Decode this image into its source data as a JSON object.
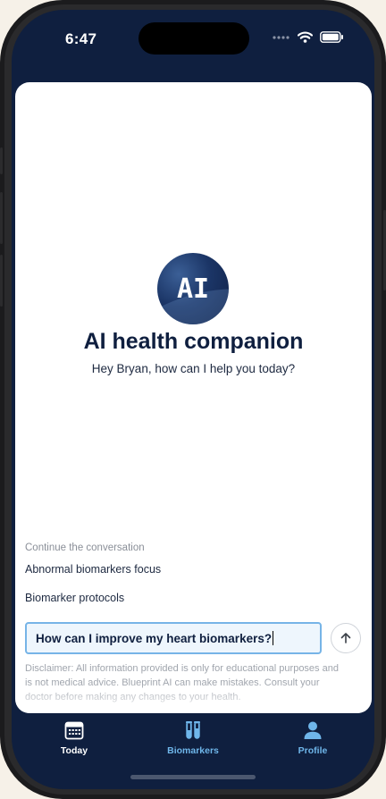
{
  "status_bar": {
    "time": "6:47"
  },
  "companion": {
    "avatar_text": "AI",
    "title": "AI health companion",
    "greeting": "Hey Bryan, how can I help you today?"
  },
  "conversation": {
    "section_label": "Continue the conversation",
    "suggestions": [
      "Abnormal biomarkers focus",
      "Biomarker protocols"
    ]
  },
  "input": {
    "value": "How can I improve my heart biomarkers?"
  },
  "disclaimer": "Disclaimer: All information provided is only for educational purposes and is not medical advice. Blueprint AI can make mistakes. Consult your doctor before making any changes to your health.",
  "tabs": [
    {
      "label": "Today",
      "icon": "calendar-icon",
      "color": "#ffffff"
    },
    {
      "label": "Biomarkers",
      "icon": "test-tubes-icon",
      "color": "#6fb6ea"
    },
    {
      "label": "Profile",
      "icon": "person-icon",
      "color": "#6fb6ea"
    }
  ],
  "colors": {
    "background": "#0f1f3f",
    "accent": "#6fb6ea",
    "input_border": "#76b4e7"
  }
}
